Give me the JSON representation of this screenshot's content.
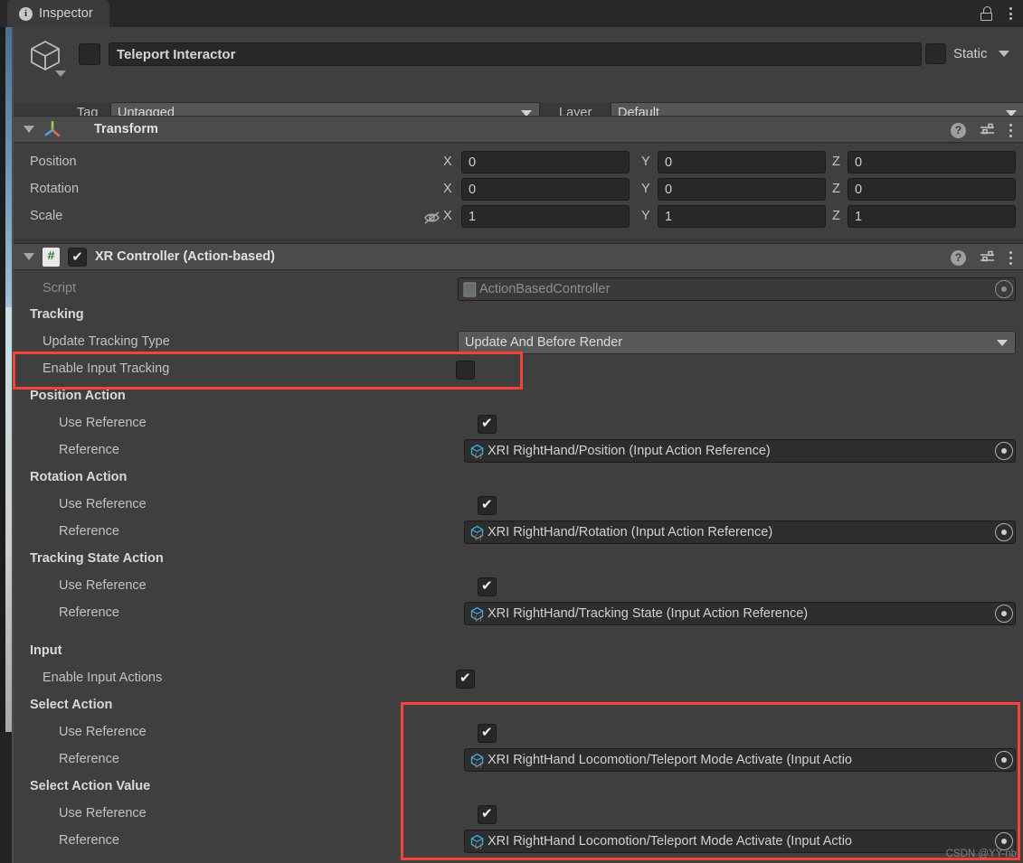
{
  "window": {
    "tab_label": "Inspector",
    "tab_icon": "info-icon",
    "lock_icon": "lock-open-icon",
    "menu_icon": "kebab-menu-icon"
  },
  "object_header": {
    "icon": "gameobject-cube-icon",
    "name_value": "Teleport Interactor",
    "enabled": false,
    "static_label": "Static",
    "static_checked": false,
    "tag_label": "Tag",
    "tag_value": "Untagged",
    "layer_label": "Layer",
    "layer_value": "Default"
  },
  "transform": {
    "title": "Transform",
    "icon": "transform-axis-icon",
    "help_icon": "help-icon",
    "preset_icon": "preset-icon",
    "menu_icon": "kebab-menu-icon",
    "rows": [
      {
        "label": "Position",
        "x": "0",
        "y": "0",
        "z": "0"
      },
      {
        "label": "Rotation",
        "x": "0",
        "y": "0",
        "z": "0"
      },
      {
        "label": "Scale",
        "x": "1",
        "y": "1",
        "z": "1",
        "constrain_icon": "constrain-proportions-off-icon"
      }
    ],
    "axis_labels": {
      "x": "X",
      "y": "Y",
      "z": "Z"
    }
  },
  "xr_controller": {
    "title": "XR Controller (Action-based)",
    "script_icon": "cs-script-icon",
    "enabled": true,
    "help_icon": "help-icon",
    "preset_icon": "preset-icon",
    "menu_icon": "kebab-menu-icon",
    "script_row": {
      "label": "Script",
      "value": "ActionBasedController",
      "icon": "cs-script-icon",
      "picker_icon": "object-picker-icon"
    },
    "tracking_header": "Tracking",
    "update_tracking_type": {
      "label": "Update Tracking Type",
      "value": "Update And Before Render"
    },
    "enable_input_tracking": {
      "label": "Enable Input Tracking",
      "checked": false
    },
    "position_action": {
      "header": "Position Action",
      "use_reference_label": "Use Reference",
      "use_reference_checked": true,
      "reference_label": "Reference",
      "reference_value": "XRI RightHand/Position (Input Action Reference)",
      "reference_icon": "input-action-reference-icon"
    },
    "rotation_action": {
      "header": "Rotation Action",
      "use_reference_label": "Use Reference",
      "use_reference_checked": true,
      "reference_label": "Reference",
      "reference_value": "XRI RightHand/Rotation (Input Action Reference)",
      "reference_icon": "input-action-reference-icon"
    },
    "tracking_state_action": {
      "header": "Tracking State Action",
      "use_reference_label": "Use Reference",
      "use_reference_checked": true,
      "reference_label": "Reference",
      "reference_value": "XRI RightHand/Tracking State (Input Action Reference)",
      "reference_icon": "input-action-reference-icon"
    },
    "input_header": "Input",
    "enable_input_actions": {
      "label": "Enable Input Actions",
      "checked": true
    },
    "select_action": {
      "header": "Select Action",
      "use_reference_label": "Use Reference",
      "use_reference_checked": true,
      "reference_label": "Reference",
      "reference_value": "XRI RightHand Locomotion/Teleport Mode Activate (Input Actio",
      "reference_icon": "input-action-reference-icon"
    },
    "select_action_value": {
      "header": "Select Action Value",
      "use_reference_label": "Use Reference",
      "use_reference_checked": true,
      "reference_label": "Reference",
      "reference_value": "XRI RightHand Locomotion/Teleport Mode Activate (Input Actio",
      "reference_icon": "input-action-reference-icon"
    }
  },
  "annotations": {
    "color": "#f2443a",
    "box_1_name": "enable-input-tracking-highlight",
    "box_2_name": "select-action-references-highlight"
  },
  "watermark": "CSDN @YY-nb"
}
